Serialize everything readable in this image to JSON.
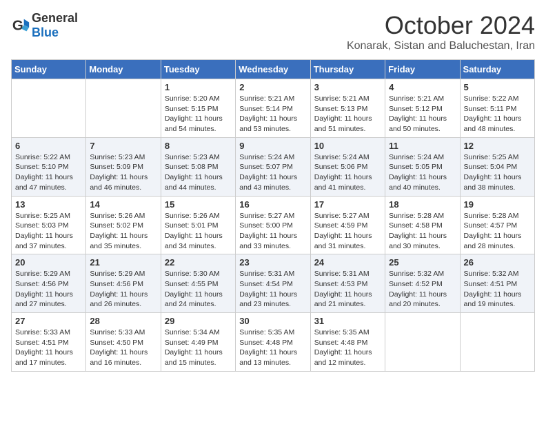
{
  "header": {
    "logo_general": "General",
    "logo_blue": "Blue",
    "month_title": "October 2024",
    "subtitle": "Konarak, Sistan and Baluchestan, Iran"
  },
  "days_of_week": [
    "Sunday",
    "Monday",
    "Tuesday",
    "Wednesday",
    "Thursday",
    "Friday",
    "Saturday"
  ],
  "weeks": [
    [
      {
        "day": "",
        "info": ""
      },
      {
        "day": "",
        "info": ""
      },
      {
        "day": "1",
        "info": "Sunrise: 5:20 AM\nSunset: 5:15 PM\nDaylight: 11 hours and 54 minutes."
      },
      {
        "day": "2",
        "info": "Sunrise: 5:21 AM\nSunset: 5:14 PM\nDaylight: 11 hours and 53 minutes."
      },
      {
        "day": "3",
        "info": "Sunrise: 5:21 AM\nSunset: 5:13 PM\nDaylight: 11 hours and 51 minutes."
      },
      {
        "day": "4",
        "info": "Sunrise: 5:21 AM\nSunset: 5:12 PM\nDaylight: 11 hours and 50 minutes."
      },
      {
        "day": "5",
        "info": "Sunrise: 5:22 AM\nSunset: 5:11 PM\nDaylight: 11 hours and 48 minutes."
      }
    ],
    [
      {
        "day": "6",
        "info": "Sunrise: 5:22 AM\nSunset: 5:10 PM\nDaylight: 11 hours and 47 minutes."
      },
      {
        "day": "7",
        "info": "Sunrise: 5:23 AM\nSunset: 5:09 PM\nDaylight: 11 hours and 46 minutes."
      },
      {
        "day": "8",
        "info": "Sunrise: 5:23 AM\nSunset: 5:08 PM\nDaylight: 11 hours and 44 minutes."
      },
      {
        "day": "9",
        "info": "Sunrise: 5:24 AM\nSunset: 5:07 PM\nDaylight: 11 hours and 43 minutes."
      },
      {
        "day": "10",
        "info": "Sunrise: 5:24 AM\nSunset: 5:06 PM\nDaylight: 11 hours and 41 minutes."
      },
      {
        "day": "11",
        "info": "Sunrise: 5:24 AM\nSunset: 5:05 PM\nDaylight: 11 hours and 40 minutes."
      },
      {
        "day": "12",
        "info": "Sunrise: 5:25 AM\nSunset: 5:04 PM\nDaylight: 11 hours and 38 minutes."
      }
    ],
    [
      {
        "day": "13",
        "info": "Sunrise: 5:25 AM\nSunset: 5:03 PM\nDaylight: 11 hours and 37 minutes."
      },
      {
        "day": "14",
        "info": "Sunrise: 5:26 AM\nSunset: 5:02 PM\nDaylight: 11 hours and 35 minutes."
      },
      {
        "day": "15",
        "info": "Sunrise: 5:26 AM\nSunset: 5:01 PM\nDaylight: 11 hours and 34 minutes."
      },
      {
        "day": "16",
        "info": "Sunrise: 5:27 AM\nSunset: 5:00 PM\nDaylight: 11 hours and 33 minutes."
      },
      {
        "day": "17",
        "info": "Sunrise: 5:27 AM\nSunset: 4:59 PM\nDaylight: 11 hours and 31 minutes."
      },
      {
        "day": "18",
        "info": "Sunrise: 5:28 AM\nSunset: 4:58 PM\nDaylight: 11 hours and 30 minutes."
      },
      {
        "day": "19",
        "info": "Sunrise: 5:28 AM\nSunset: 4:57 PM\nDaylight: 11 hours and 28 minutes."
      }
    ],
    [
      {
        "day": "20",
        "info": "Sunrise: 5:29 AM\nSunset: 4:56 PM\nDaylight: 11 hours and 27 minutes."
      },
      {
        "day": "21",
        "info": "Sunrise: 5:29 AM\nSunset: 4:56 PM\nDaylight: 11 hours and 26 minutes."
      },
      {
        "day": "22",
        "info": "Sunrise: 5:30 AM\nSunset: 4:55 PM\nDaylight: 11 hours and 24 minutes."
      },
      {
        "day": "23",
        "info": "Sunrise: 5:31 AM\nSunset: 4:54 PM\nDaylight: 11 hours and 23 minutes."
      },
      {
        "day": "24",
        "info": "Sunrise: 5:31 AM\nSunset: 4:53 PM\nDaylight: 11 hours and 21 minutes."
      },
      {
        "day": "25",
        "info": "Sunrise: 5:32 AM\nSunset: 4:52 PM\nDaylight: 11 hours and 20 minutes."
      },
      {
        "day": "26",
        "info": "Sunrise: 5:32 AM\nSunset: 4:51 PM\nDaylight: 11 hours and 19 minutes."
      }
    ],
    [
      {
        "day": "27",
        "info": "Sunrise: 5:33 AM\nSunset: 4:51 PM\nDaylight: 11 hours and 17 minutes."
      },
      {
        "day": "28",
        "info": "Sunrise: 5:33 AM\nSunset: 4:50 PM\nDaylight: 11 hours and 16 minutes."
      },
      {
        "day": "29",
        "info": "Sunrise: 5:34 AM\nSunset: 4:49 PM\nDaylight: 11 hours and 15 minutes."
      },
      {
        "day": "30",
        "info": "Sunrise: 5:35 AM\nSunset: 4:48 PM\nDaylight: 11 hours and 13 minutes."
      },
      {
        "day": "31",
        "info": "Sunrise: 5:35 AM\nSunset: 4:48 PM\nDaylight: 11 hours and 12 minutes."
      },
      {
        "day": "",
        "info": ""
      },
      {
        "day": "",
        "info": ""
      }
    ]
  ]
}
